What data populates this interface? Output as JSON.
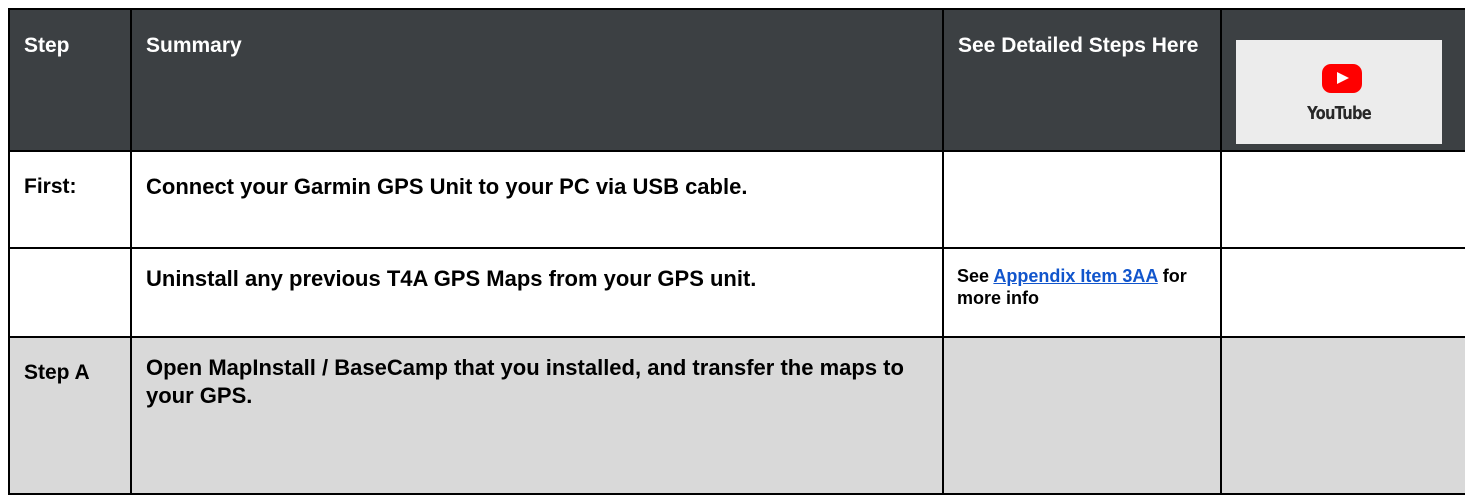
{
  "header": {
    "step": "Step",
    "summary": "Summary",
    "details": "See Detailed Steps Here",
    "youtube_logo_text": "YouTube",
    "youtube_icon": "youtube-play-icon"
  },
  "rows": [
    {
      "step": "First:",
      "summary": "Connect your Garmin GPS Unit to your PC via USB cable.",
      "details": ""
    },
    {
      "step": "",
      "summary": "Uninstall any previous T4A GPS Maps from your GPS unit.",
      "details_prefix": "See ",
      "details_link": "Appendix Item 3AA",
      "details_suffix": " for more info"
    },
    {
      "step": "Step A",
      "summary": "Open  MapInstall / BaseCamp that you installed, and transfer the maps to your GPS.",
      "details": ""
    }
  ],
  "colors": {
    "header_bg": "#3c4043",
    "row_shaded": "#d9d9d9",
    "link": "#1155cc",
    "youtube_red": "#ff0000"
  }
}
